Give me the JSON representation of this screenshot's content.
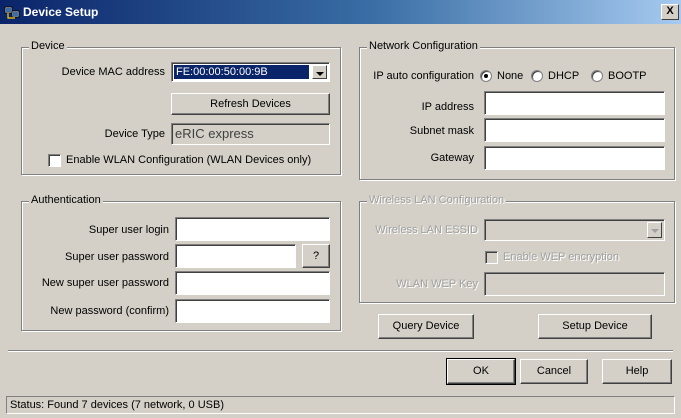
{
  "window": {
    "title": "Device Setup",
    "close_label": "X"
  },
  "device": {
    "legend": "Device",
    "mac_label": "Device MAC address",
    "mac_value": "FE:00:00:50:00:9B",
    "refresh_label": "Refresh Devices",
    "type_label": "Device Type",
    "type_value": "eRIC express",
    "wlan_checkbox_label": "Enable WLAN Configuration (WLAN Devices only)",
    "wlan_checked": false
  },
  "network": {
    "legend": "Network Configuration",
    "auto_label": "IP auto configuration",
    "options": [
      "None",
      "DHCP",
      "BOOTP"
    ],
    "selected": "None",
    "ip_label": "IP address",
    "ip_value": "",
    "subnet_label": "Subnet mask",
    "subnet_value": "",
    "gateway_label": "Gateway",
    "gateway_value": ""
  },
  "auth": {
    "legend": "Authentication",
    "login_label": "Super user login",
    "login_value": "",
    "password_label": "Super user password",
    "password_value": "",
    "help_label": "?",
    "new_password_label": "New super user password",
    "new_password_value": "",
    "confirm_label": "New password (confirm)",
    "confirm_value": ""
  },
  "wireless": {
    "legend": "Wireless LAN Configuration",
    "essid_label": "Wireless LAN ESSID",
    "essid_value": "",
    "wep_label": "Enable WEP encryption",
    "wep_checked": false,
    "key_label": "WLAN WEP Key",
    "key_value": ""
  },
  "actions": {
    "query_label": "Query Device",
    "setup_label": "Setup Device",
    "ok_label": "OK",
    "cancel_label": "Cancel",
    "help_label": "Help"
  },
  "status": {
    "text": "Status: Found 7 devices (7 network, 0 USB)"
  }
}
